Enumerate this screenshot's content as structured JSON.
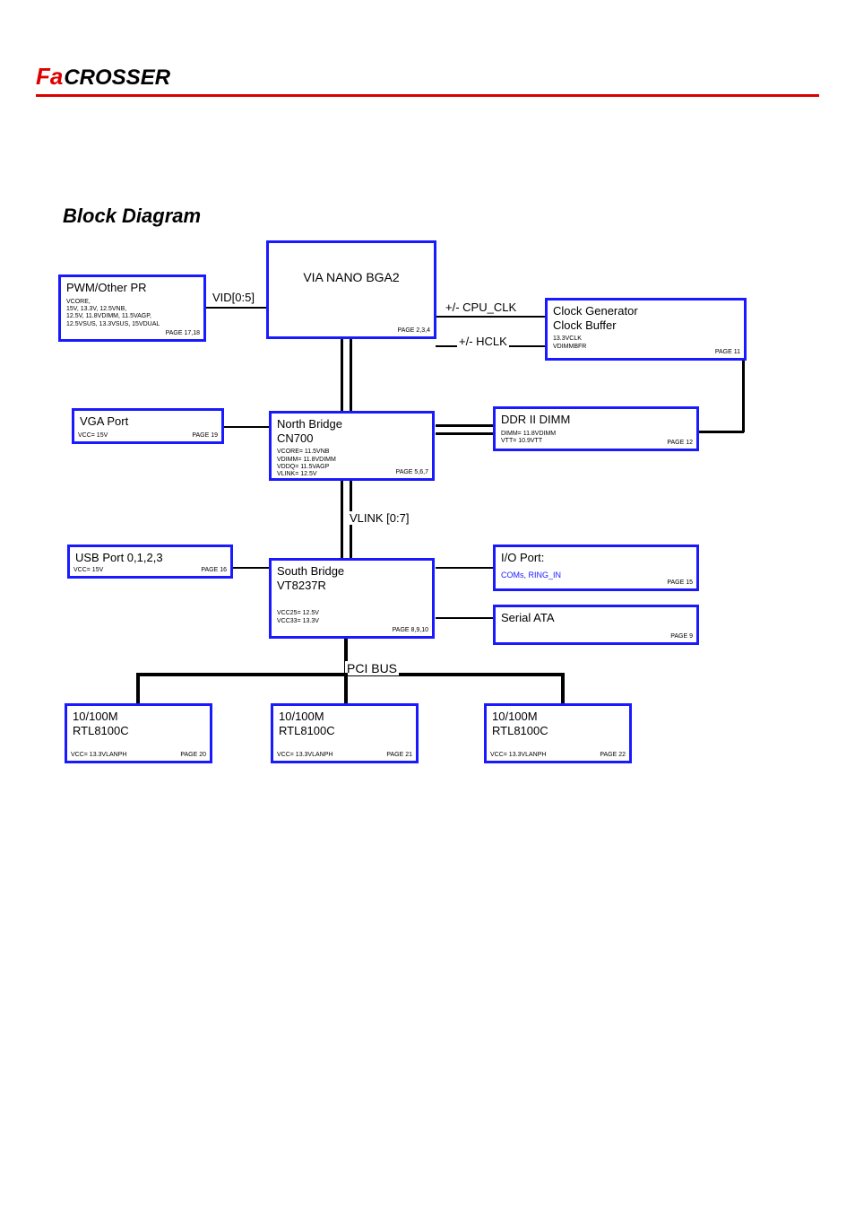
{
  "logo": {
    "mark": "Fa",
    "text": "CROSSER"
  },
  "page_title": "Block Diagram",
  "labels": {
    "vid": "VID[0:5]",
    "cpu_clk": "+/- CPU_CLK",
    "hclk": "+/- HCLK",
    "vlink": "VLINK [0:7]",
    "pci_bus": "PCI BUS"
  },
  "blocks": {
    "pwm": {
      "title": "PWM/Other PR",
      "sub": "VCORE,\n15V, 13.3V, 12.5VNB,\n12.5V, 11.8VDIMM, 11.5VAGP,\n12.5VSUS, 13.3VSUS, 15VDUAL",
      "page": "PAGE 17,18"
    },
    "cpu": {
      "title": "VIA NANO BGA2",
      "page": "PAGE 2,3,4"
    },
    "clock": {
      "title": "Clock Generator\nClock Buffer",
      "sub": "13.3VCLK\nVDIMMBFR",
      "page": "PAGE 11"
    },
    "vga": {
      "title": "VGA Port",
      "sub": "VCC= 15V",
      "page": "PAGE 19"
    },
    "nb": {
      "title": "North Bridge\nCN700",
      "sub": "VCORE= 11.5VNB\nVDIMM= 11.8VDIMM\nVDDQ= 11.5VAGP\nVLINK= 12.5V",
      "page": "PAGE 5,6,7"
    },
    "ddr": {
      "title": "DDR II DIMM",
      "sub": "DIMM= 11.8VDIMM\nVTT= 10.9VTT",
      "page": "PAGE 12"
    },
    "usb": {
      "title": "USB Port 0,1,2,3",
      "sub": "VCC= 15V",
      "page": "PAGE 16"
    },
    "sb": {
      "title": "South Bridge\nVT8237R",
      "sub": "VCC25= 12.5V\nVCC33= 13.3V",
      "page": "PAGE 8,9,10"
    },
    "io": {
      "title": "I/O Port:",
      "sub": "COMs, RING_IN",
      "page": "PAGE 15"
    },
    "sata": {
      "title": "Serial ATA",
      "page": "PAGE 9"
    },
    "lan1": {
      "title": "10/100M\nRTL8100C",
      "sub": "VCC= 13.3VLANPH",
      "page": "PAGE 20"
    },
    "lan2": {
      "title": "10/100M\nRTL8100C",
      "sub": "VCC= 13.3VLANPH",
      "page": "PAGE 21"
    },
    "lan3": {
      "title": "10/100M\nRTL8100C",
      "sub": "VCC= 13.3VLANPH",
      "page": "PAGE 22"
    }
  }
}
